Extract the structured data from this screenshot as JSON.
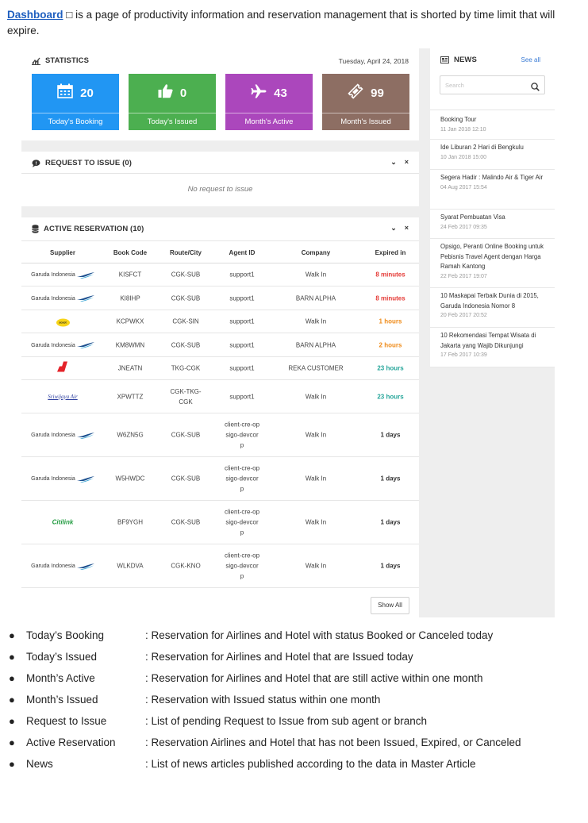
{
  "intro": {
    "link": "Dashboard",
    "text": " □ is a page of productivity information and reservation management that is shorted by time limit that will expire."
  },
  "statistics": {
    "title": "STATISTICS",
    "date": "Tuesday, April 24, 2018",
    "tiles": [
      {
        "value": "20",
        "label": "Today's Booking",
        "color": "#2196f3",
        "icon": "calendar-icon"
      },
      {
        "value": "0",
        "label": "Today's Issued",
        "color": "#4caf50",
        "icon": "thumbs-up-icon"
      },
      {
        "value": "43",
        "label": "Month's Active",
        "color": "#ab47bc",
        "icon": "airplane-icon"
      },
      {
        "value": "99",
        "label": "Month's Issued",
        "color": "#8d6e63",
        "icon": "ticket-icon"
      }
    ]
  },
  "request": {
    "title": "REQUEST TO ISSUE (0)",
    "empty": "No request to issue",
    "collapse": "⌄",
    "close": "×"
  },
  "active": {
    "title": "ACTIVE RESERVATION (10)",
    "collapse": "⌄",
    "close": "×",
    "columns": [
      "Supplier",
      "Book Code",
      "Route/City",
      "Agent ID",
      "Company",
      "Expired in"
    ],
    "rows": [
      {
        "supplier": "Garuda Indonesia",
        "code": "KISFCT",
        "route": "CGK-SUB",
        "agent": "support1",
        "company": "Walk In",
        "expired": "8 minutes",
        "color": "#e53935"
      },
      {
        "supplier": "Garuda Indonesia",
        "code": "KI8IHP",
        "route": "CGK-SUB",
        "agent": "support1",
        "company": "BARN ALPHA",
        "expired": "8 minutes",
        "color": "#e53935"
      },
      {
        "supplier": "scoot",
        "code": "KCPWKX",
        "route": "CGK-SIN",
        "agent": "support1",
        "company": "Walk In",
        "expired": "1 hours",
        "color": "#ef8a17"
      },
      {
        "supplier": "Garuda Indonesia",
        "code": "KM8WMN",
        "route": "CGK-SUB",
        "agent": "support1",
        "company": "BARN ALPHA",
        "expired": "2 hours",
        "color": "#ef8a17"
      },
      {
        "supplier": "AirAsia",
        "code": "JNEATN",
        "route": "TKG-CGK",
        "agent": "support1",
        "company": "REKA CUSTOMER",
        "expired": "23 hours",
        "color": "#26a69a"
      },
      {
        "supplier": "Sriwijaya Air",
        "code": "XPWTTZ",
        "route": "CGK-TKG-CGK",
        "agent": "support1",
        "company": "Walk In",
        "expired": "23 hours",
        "color": "#26a69a"
      },
      {
        "supplier": "Garuda Indonesia",
        "code": "W6ZN5G",
        "route": "CGK-SUB",
        "agent": "client-cre-opsigo-devcorp",
        "company": "Walk In",
        "expired": "1 days",
        "color": "#333333"
      },
      {
        "supplier": "Garuda Indonesia",
        "code": "W5HWDC",
        "route": "CGK-SUB",
        "agent": "client-cre-opsigo-devcorp",
        "company": "Walk In",
        "expired": "1 days",
        "color": "#333333"
      },
      {
        "supplier": "Citilink",
        "code": "BF9YGH",
        "route": "CGK-SUB",
        "agent": "client-cre-opsigo-devcorp",
        "company": "Walk In",
        "expired": "1 days",
        "color": "#333333"
      },
      {
        "supplier": "Garuda Indonesia",
        "code": "WLKDVA",
        "route": "CGK-KNO",
        "agent": "client-cre-opsigo-devcorp",
        "company": "Walk In",
        "expired": "1 days",
        "color": "#333333"
      }
    ],
    "show_all": "Show All"
  },
  "news": {
    "title": "NEWS",
    "see_all": "See all",
    "search_placeholder": "Search",
    "items": [
      {
        "title": "Booking Tour",
        "date": "11 Jan 2018 12:10"
      },
      {
        "title": "Ide Liburan 2 Hari di Bengkulu",
        "date": "10 Jan 2018 15:00"
      },
      {
        "title": "Segera Hadir : Malindo Air & Tiger Air",
        "date": "04 Aug 2017 15:54"
      },
      {
        "title": "Syarat Pembuatan Visa",
        "date": "24 Feb 2017 09:35"
      },
      {
        "title": "Opsigo, Peranti Online Booking untuk Pebisnis Travel Agent dengan Harga Ramah Kantong",
        "date": "22 Feb 2017 19:07"
      },
      {
        "title": "10 Maskapai Terbaik Dunia di 2015, Garuda Indonesia Nomor 8",
        "date": "20 Feb 2017 20:52"
      },
      {
        "title": "10 Rekomendasi Tempat Wisata di Jakarta yang Wajib Dikunjungi",
        "date": "17 Feb 2017 10:39"
      }
    ]
  },
  "bullets": [
    {
      "term": "Today’s Booking",
      "desc": ": Reservation for Airlines and Hotel with status Booked or Canceled today"
    },
    {
      "term": "Today’s Issued",
      "desc": ": Reservation for Airlines and Hotel that are Issued today"
    },
    {
      "term": "Month’s Active",
      "desc": ": Reservation for Airlines and Hotel that are still active within one month"
    },
    {
      "term": "Month’s Issued",
      "desc": ": Reservation with Issued  status within one month"
    },
    {
      "term": "Request to Issue",
      "desc": ": List of pending Request to Issue from sub agent or branch"
    },
    {
      "term": "Active Reservation",
      "desc": ": Reservation Airlines and Hotel that has not been Issued, Expired, or Canceled"
    },
    {
      "term": "News",
      "desc": ": List of news articles published according to the data in Master Article"
    }
  ]
}
